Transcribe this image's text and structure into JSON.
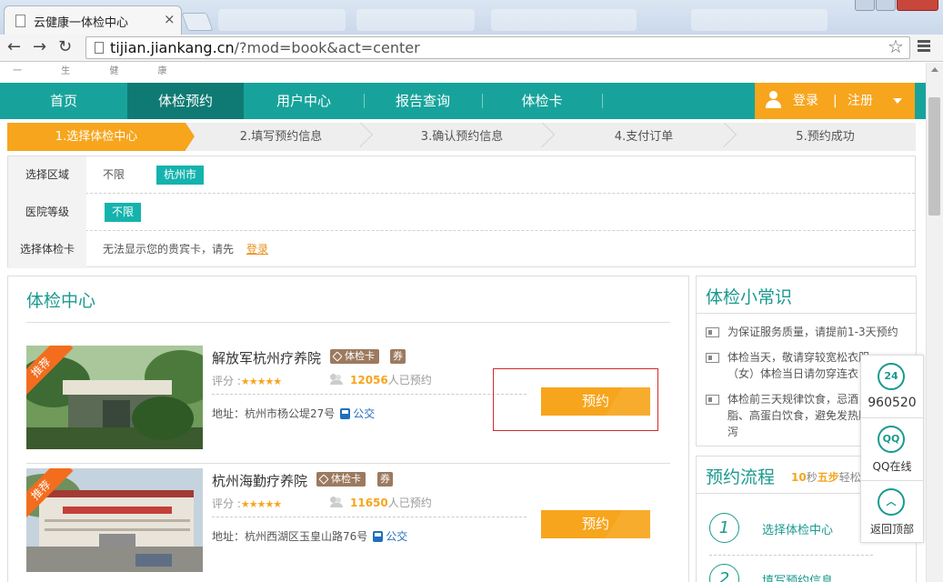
{
  "browser": {
    "tab_title": "云健康一体检中心",
    "tab_close": "×",
    "url_host": "tijian.jiankang.cn",
    "url_path": "/?mod=book&act=center",
    "back": "←",
    "forward": "→",
    "reload": "↻",
    "star": "☆"
  },
  "slogan": "一 生 健 康",
  "nav": {
    "items": [
      "首页",
      "体检预约",
      "用户中心",
      "报告查询",
      "体检卡"
    ],
    "login": "登录",
    "sep": "|",
    "register": "注册"
  },
  "steps": [
    "1.选择体检中心",
    "2.填写预约信息",
    "3.确认预约信息",
    "4.支付订单",
    "5.预约成功"
  ],
  "filters": {
    "region_label": "选择区域",
    "region_any": "不限",
    "region_city": "杭州市",
    "level_label": "医院等级",
    "level_any": "不限",
    "card_label": "选择体检卡",
    "card_text": "无法显示您的贵宾卡，请先",
    "card_login": "登录"
  },
  "centers": {
    "title": "体检中心",
    "rating_label": "评分 :",
    "stars": "★★★★★",
    "booked_suffix": "人已预约",
    "bus_label": "公交",
    "book_label": "预约",
    "ribbon": "推荐",
    "list": [
      {
        "name": "解放军杭州疗养院",
        "tag_card": "体检卡",
        "tag_coupon": "券",
        "booked": "12056",
        "address": "地址：杭州市杨公堤27号"
      },
      {
        "name": "杭州海勤疗养院",
        "tag_card": "体检卡",
        "tag_coupon": "券",
        "booked": "11650",
        "address": "地址：杭州西湖区玉皇山路76号"
      }
    ]
  },
  "tips": {
    "title": "体检小常识",
    "items": [
      "为保证服务质量，请提前1-3天预约",
      "体检当天，敬请穿较宽松衣服（女）体检当日请勿穿连衣裙、连",
      "体检前三天规律饮食，忌酒，脂、高蛋白饮食，避免发热腹泻"
    ]
  },
  "flow": {
    "title": "预约流程",
    "sub_num": "10",
    "sub_mid": "秒",
    "sub_steps": "五步",
    "sub_end": "轻松",
    "steps": [
      {
        "num": "1",
        "label": "选择体检中心"
      },
      {
        "num": "2",
        "label": "填写预约信息"
      }
    ]
  },
  "float_bar": {
    "phone_icon": "24",
    "phone": "960520",
    "qq_icon": "QQ",
    "qq": "QQ在线",
    "top_icon": "︿",
    "top": "返回顶部"
  },
  "colors": {
    "teal": "#17a39b",
    "teal_dark": "#0f7a73",
    "orange": "#f7a51d",
    "highlight_red": "#d32a2a"
  }
}
